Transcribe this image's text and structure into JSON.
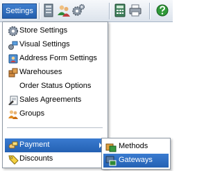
{
  "toolbar": {
    "settings_label": "Settings",
    "icons": [
      "catalog-icon",
      "users-icon",
      "gears-icon",
      "calculator-icon",
      "printer-icon",
      "help-icon"
    ]
  },
  "menu": {
    "items": [
      {
        "label": "Store Settings",
        "icon": "gear-icon"
      },
      {
        "label": "Visual Settings",
        "icon": "visual-icon"
      },
      {
        "label": "Address Form Settings",
        "icon": "address-book-icon"
      },
      {
        "label": "Warehouses",
        "icon": "warehouse-icon"
      },
      {
        "label": "Order Status Options",
        "icon": ""
      },
      {
        "label": "Sales Agreements",
        "icon": "agreement-icon"
      },
      {
        "label": "Groups",
        "icon": "groups-icon"
      },
      {
        "label": "Payment",
        "icon": "payment-icon",
        "has_submenu": true,
        "active": true
      },
      {
        "label": "Discounts",
        "icon": "tag-icon"
      }
    ]
  },
  "submenu": {
    "items": [
      {
        "label": "Methods",
        "icon": "methods-icon"
      },
      {
        "label": "Gateways",
        "icon": "gateway-icon",
        "active": true
      }
    ]
  },
  "colors": {
    "highlight": "#2c6cc1",
    "toolbar_button": "#2f6fc2",
    "menu_border": "#8c96a2"
  }
}
